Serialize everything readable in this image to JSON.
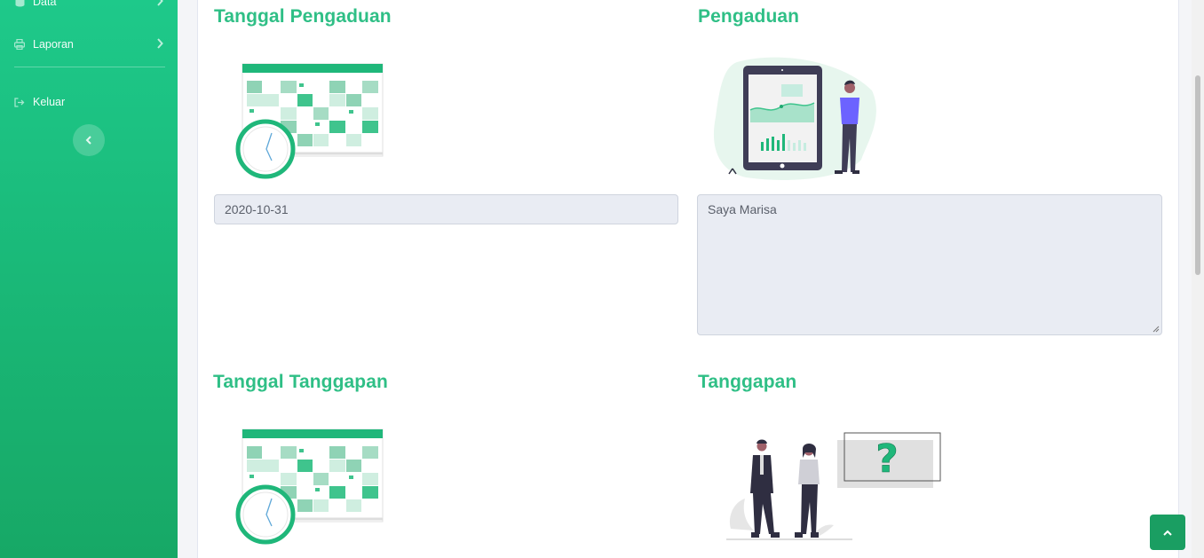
{
  "sidebar": {
    "items": [
      {
        "label": "Data",
        "icon": "database-icon"
      },
      {
        "label": "Laporan",
        "icon": "printer-icon"
      },
      {
        "label": "Keluar",
        "icon": "sign-out-icon"
      }
    ],
    "collapse_icon": "chevron-left-icon"
  },
  "sections": {
    "tanggal_pengaduan": {
      "title": "Tanggal Pengaduan",
      "value": "2020-10-31"
    },
    "pengaduan": {
      "title": "Pengaduan",
      "value": "Saya Marisa"
    },
    "tanggal_tanggapan": {
      "title": "Tanggal Tanggapan"
    },
    "tanggapan": {
      "title": "Tanggapan"
    }
  },
  "colors": {
    "accent": "#2fbf86",
    "sidebar": "#1ec98a",
    "fab": "#1a9e62"
  }
}
